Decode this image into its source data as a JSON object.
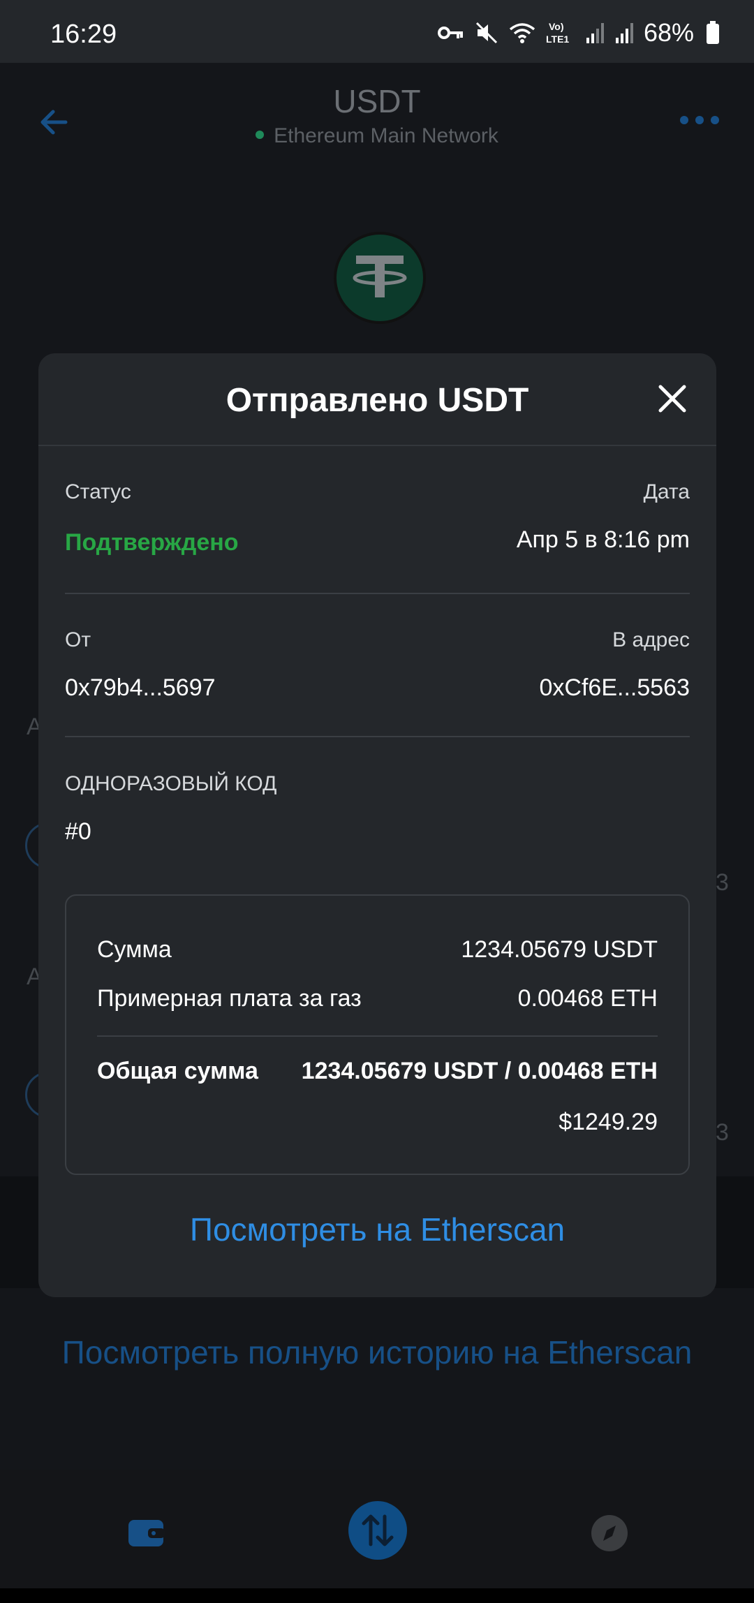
{
  "status_bar": {
    "time": "16:29",
    "battery": "68%",
    "network_badge": "Vo) LTE1",
    "icons": [
      "key-icon",
      "mute-icon",
      "wifi-icon",
      "signal-icon",
      "signal-icon",
      "battery-icon"
    ]
  },
  "header": {
    "title": "USDT",
    "network": "Ethereum Main Network",
    "network_dot_color": "#1f8a5a"
  },
  "token": {
    "logo_letter": "T",
    "logo_color": "#0c3a2b"
  },
  "background_list": {
    "rows": [
      {
        "letter": "A",
        "amount_fragment": "3"
      },
      {
        "letter": "A",
        "amount_fragment": "3"
      }
    ]
  },
  "history_link": "Посмотреть полную историю на Etherscan",
  "modal": {
    "title": "Отправлено USDT",
    "status_label": "Статус",
    "status_value": "Подтверждено",
    "status_color": "#28a745",
    "date_label": "Дата",
    "date_value": "Апр 5 в 8:16 pm",
    "from_label": "От",
    "from_value": "0x79b4...5697",
    "to_label": "В адрес",
    "to_value": "0xCf6E...5563",
    "nonce_label": "ОДНОРАЗОВЫЙ КОД",
    "nonce_value": "#0",
    "summary": {
      "amount_label": "Сумма",
      "amount_value": "1234.05679 USDT",
      "gas_label": "Примерная плата за газ",
      "gas_value": "0.00468 ETH",
      "total_label": "Общая сумма",
      "total_value": "1234.05679 USDT / 0.00468 ETH",
      "total_fiat": "$1249.29"
    },
    "etherscan_link": "Посмотреть на Etherscan",
    "link_color": "#2f8ee4"
  },
  "bottom_nav": {
    "items": [
      "wallet-icon",
      "swap-icon",
      "explore-icon"
    ],
    "accent": "#0f4d85"
  }
}
